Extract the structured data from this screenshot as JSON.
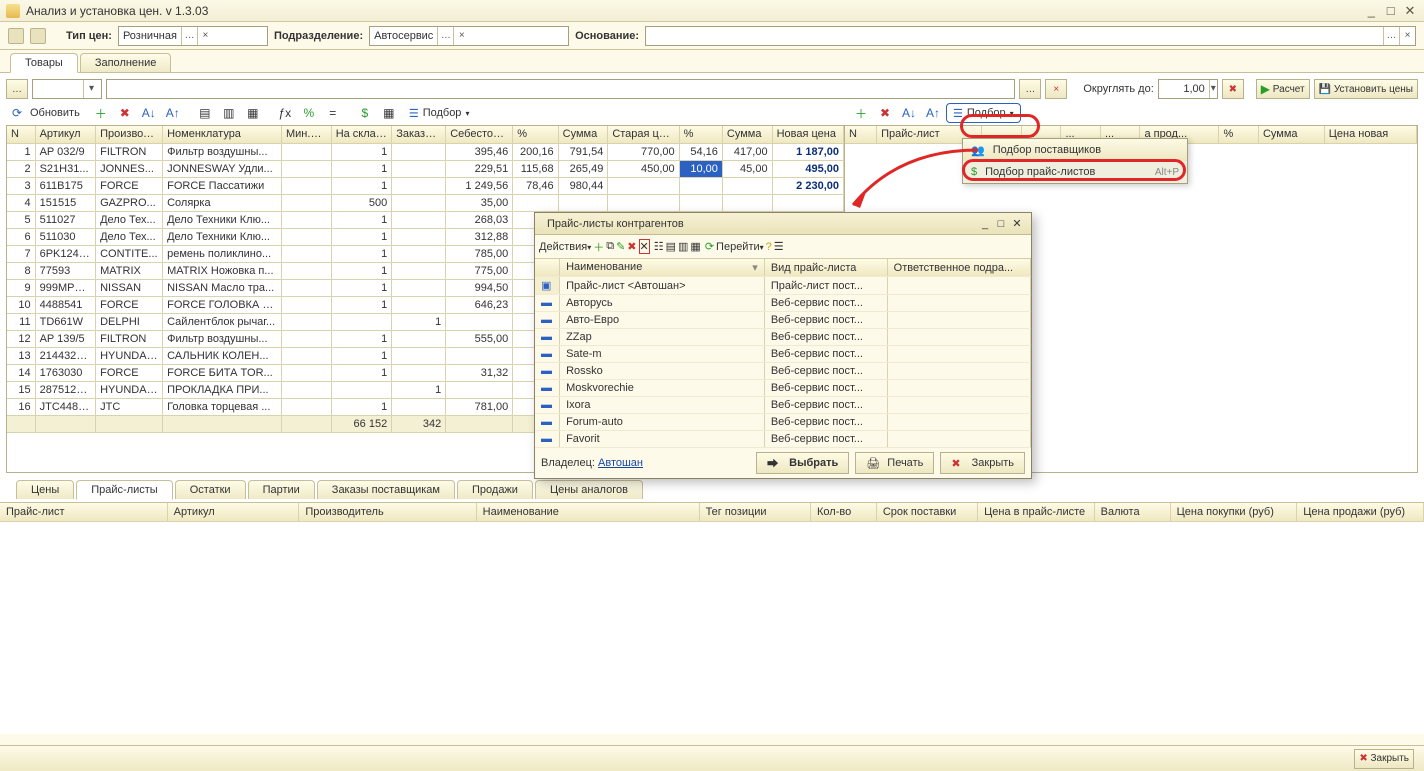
{
  "window": {
    "title": "Анализ и установка цен. v 1.3.03"
  },
  "filters": {
    "price_type_label": "Тип цен:",
    "price_type_value": "Розничная",
    "subdivision_label": "Подразделение:",
    "subdivision_value": "Автосервис",
    "basis_label": "Основание:",
    "basis_value": ""
  },
  "maintabs": {
    "goods": "Товары",
    "fill": "Заполнение"
  },
  "toolbar": {
    "round_label": "Округлять до:",
    "round_value": "1,00",
    "calc": "Расчет",
    "set_prices": "Установить цены",
    "refresh": "Обновить",
    "pick": "Подбор"
  },
  "left_columns": [
    "N",
    "Артикул",
    "Производ...",
    "Номенклатура",
    "Мин.ост",
    "На складе",
    "Заказано",
    "Себестоим...",
    "%",
    "Сумма",
    "Старая цена",
    "%",
    "Сумма",
    "Новая цена"
  ],
  "left_widths": [
    26,
    56,
    62,
    110,
    46,
    56,
    50,
    62,
    42,
    46,
    66,
    40,
    46,
    66
  ],
  "rows": [
    {
      "n": "1",
      "art": "AP 032/9",
      "prod": "FILTRON",
      "nom": "Фильтр воздушны...",
      "min": "",
      "stk": "1",
      "ord": "",
      "cost": "395,46",
      "p1": "200,16",
      "s1": "791,54",
      "old": "770,00",
      "p2": "54,16",
      "s2": "417,00",
      "newp": "1 187,00"
    },
    {
      "n": "2",
      "art": "S21H31...",
      "prod": "JONNES...",
      "nom": "JONNESWAY Удли...",
      "min": "",
      "stk": "1",
      "ord": "",
      "cost": "229,51",
      "p1": "115,68",
      "s1": "265,49",
      "old": "450,00",
      "p2": "10,00",
      "s2": "45,00",
      "newp": "495,00",
      "selP2": true
    },
    {
      "n": "3",
      "art": "611B175",
      "prod": "FORCE",
      "nom": "FORCE Пассатижи",
      "min": "",
      "stk": "1",
      "ord": "",
      "cost": "1 249,56",
      "p1": "78,46",
      "s1": "980,44",
      "old": "",
      "p2": "",
      "s2": "",
      "newp": "2 230,00"
    },
    {
      "n": "4",
      "art": "151515",
      "prod": "GAZPRO...",
      "nom": "Солярка",
      "min": "",
      "stk": "500",
      "ord": "",
      "cost": "35,00",
      "p1": "",
      "s1": "",
      "old": "",
      "p2": "",
      "s2": "",
      "newp": ""
    },
    {
      "n": "5",
      "art": "511027",
      "prod": "Дело Тех...",
      "nom": "Дело Техники Клю...",
      "min": "",
      "stk": "1",
      "ord": "",
      "cost": "268,03",
      "p1": "",
      "s1": "",
      "old": "",
      "p2": "",
      "s2": "",
      "newp": ""
    },
    {
      "n": "6",
      "art": "511030",
      "prod": "Дело Тех...",
      "nom": "Дело Техники Клю...",
      "min": "",
      "stk": "1",
      "ord": "",
      "cost": "312,88",
      "p1": "",
      "s1": "",
      "old": "",
      "p2": "",
      "s2": "",
      "newp": ""
    },
    {
      "n": "7",
      "art": "6PK1240...",
      "prod": "CONTITE...",
      "nom": "ремень поликлино...",
      "min": "",
      "stk": "1",
      "ord": "",
      "cost": "785,00",
      "p1": "",
      "s1": "",
      "old": "",
      "p2": "",
      "s2": "",
      "newp": ""
    },
    {
      "n": "8",
      "art": "77593",
      "prod": "MATRIX",
      "nom": "MATRIX Ножовка п...",
      "min": "",
      "stk": "1",
      "ord": "",
      "cost": "775,00",
      "p1": "",
      "s1": "",
      "old": "",
      "p2": "",
      "s2": "",
      "newp": ""
    },
    {
      "n": "9",
      "art": "999MPN...",
      "prod": "NISSAN",
      "nom": "NISSAN Масло тра...",
      "min": "",
      "stk": "1",
      "ord": "",
      "cost": "994,50",
      "p1": "",
      "s1": "",
      "old": "",
      "p2": "",
      "s2": "",
      "newp": ""
    },
    {
      "n": "10",
      "art": "4488541",
      "prod": "FORCE",
      "nom": "FORCE ГОЛОВКА 1...",
      "min": "",
      "stk": "1",
      "ord": "",
      "cost": "646,23",
      "p1": "",
      "s1": "",
      "old": "",
      "p2": "",
      "s2": "",
      "newp": ""
    },
    {
      "n": "11",
      "art": "TD661W",
      "prod": "DELPHI",
      "nom": "Сайлентблок рычаг...",
      "min": "",
      "stk": "",
      "ord": "1",
      "cost": "",
      "p1": "",
      "s1": "",
      "old": "",
      "p2": "",
      "s2": "",
      "newp": ""
    },
    {
      "n": "12",
      "art": "AP 139/5",
      "prod": "FILTRON",
      "nom": "Фильтр воздушны...",
      "min": "",
      "stk": "1",
      "ord": "",
      "cost": "555,00",
      "p1": "",
      "s1": "",
      "old": "",
      "p2": "",
      "s2": "",
      "newp": ""
    },
    {
      "n": "13",
      "art": "214432B...",
      "prod": "HYUNDAI...",
      "nom": "САЛЬНИК КОЛЕН...",
      "min": "",
      "stk": "1",
      "ord": "",
      "cost": "",
      "p1": "",
      "s1": "",
      "old": "",
      "p2": "",
      "s2": "",
      "newp": ""
    },
    {
      "n": "14",
      "art": "1763030",
      "prod": "FORCE",
      "nom": "FORCE БИТА TOR...",
      "min": "",
      "stk": "1",
      "ord": "",
      "cost": "31,32",
      "p1": "",
      "s1": "",
      "old": "",
      "p2": "",
      "s2": "",
      "newp": ""
    },
    {
      "n": "15",
      "art": "287512B...",
      "prod": "HYUNDAI...",
      "nom": "ПРОКЛАДКА ПРИ...",
      "min": "",
      "stk": "",
      "ord": "1",
      "cost": "",
      "p1": "",
      "s1": "",
      "old": "",
      "p2": "",
      "s2": "",
      "newp": ""
    },
    {
      "n": "16",
      "art": "JTC4483...",
      "prod": "JTC",
      "nom": "Головка торцевая ...",
      "min": "",
      "stk": "1",
      "ord": "",
      "cost": "781,00",
      "p1": "",
      "s1": "",
      "old": "",
      "p2": "",
      "s2": "",
      "newp": ""
    }
  ],
  "totals": {
    "stk": "66 152",
    "ord": "342"
  },
  "right_columns": [
    "N",
    "Прайс-лист",
    "...",
    "...",
    "...",
    "...",
    "а прод...",
    "%",
    "Сумма",
    "Цена новая"
  ],
  "dropdown": {
    "item1": "Подбор поставщиков",
    "item2": "Подбор прайс-листов",
    "hotkey": "Alt+P"
  },
  "subtabs": {
    "prices": "Цены",
    "pricelists": "Прайс-листы",
    "remains": "Остатки",
    "batches": "Партии",
    "orders": "Заказы поставщикам",
    "sales": "Продажи",
    "analogs": "Цены аналогов"
  },
  "detail_columns": [
    "Прайс-лист",
    "Артикул",
    "Производитель",
    "Наименование",
    "Тег позиции",
    "Кол-во",
    "Срок поставки",
    "Цена в прайс-листе",
    "Валюта",
    "Цена покупки (руб)",
    "Цена продажи (руб)"
  ],
  "dialog": {
    "title": "Прайс-листы контрагентов",
    "actions": "Действия",
    "go": "Перейти",
    "cols": [
      "",
      "Наименование",
      "Вид прайс-листа",
      "Ответственное подра..."
    ],
    "rows": [
      {
        "name": "Прайс-лист <Автошан>",
        "kind": "Прайс-лист пост..."
      },
      {
        "name": "Авторусь",
        "kind": "Веб-сервис пост..."
      },
      {
        "name": "Авто-Евро",
        "kind": "Веб-сервис пост..."
      },
      {
        "name": "ZZap",
        "kind": "Веб-сервис пост..."
      },
      {
        "name": "Sate-m",
        "kind": "Веб-сервис пост..."
      },
      {
        "name": "Rossko",
        "kind": "Веб-сервис пост..."
      },
      {
        "name": "Moskvorechie",
        "kind": "Веб-сервис пост..."
      },
      {
        "name": "Ixora",
        "kind": "Веб-сервис пост..."
      },
      {
        "name": "Forum-auto",
        "kind": "Веб-сервис пост..."
      },
      {
        "name": "Favorit",
        "kind": "Веб-сервис пост..."
      }
    ],
    "owner_label": "Владелец:",
    "owner_value": "Автошан",
    "select": "Выбрать",
    "print": "Печать",
    "close": "Закрыть"
  },
  "footer": {
    "close": "Закрыть"
  }
}
